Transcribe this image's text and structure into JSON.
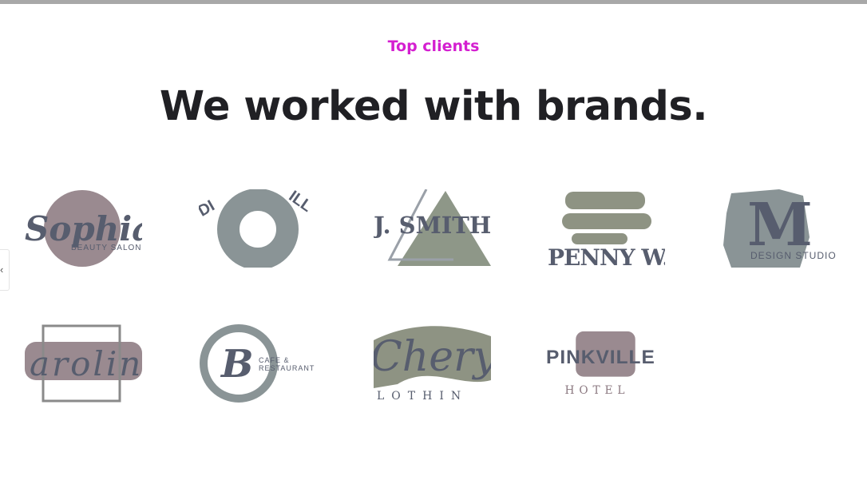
{
  "section": {
    "eyebrow": "Top clients",
    "heading": "We worked with brands."
  },
  "carousel": {
    "prev_icon": "chevron-left-icon"
  },
  "colors": {
    "eyebrow": "#d41fd0",
    "heading": "#202024",
    "logo_grey": "#8a9496",
    "logo_mauve": "#9a8a90",
    "logo_ink": "#575d6e"
  },
  "logos": [
    {
      "name": "sophia-beauty-salon",
      "text": "Sophia",
      "sub": "BEAUTY SALON"
    },
    {
      "name": "dianaville",
      "text": "DI",
      "sub": "ILL"
    },
    {
      "name": "j-smith",
      "text": "J. SMITH"
    },
    {
      "name": "penny-w",
      "text": "PENNY W."
    },
    {
      "name": "m-design-studio",
      "text": "M",
      "sub": "DESIGN STUDIO"
    },
    {
      "name": "caroline",
      "text": "arolin"
    },
    {
      "name": "b-cafe-restaurant",
      "text": "B",
      "sub": "CAFE &",
      "sub2": "RESTAURANT"
    },
    {
      "name": "cheryl-clothing",
      "text": "Cheryl",
      "sub": "LOTHIN"
    },
    {
      "name": "pinkville-hotel",
      "text": "PINKVILLE",
      "sub": "HOTEL"
    }
  ]
}
